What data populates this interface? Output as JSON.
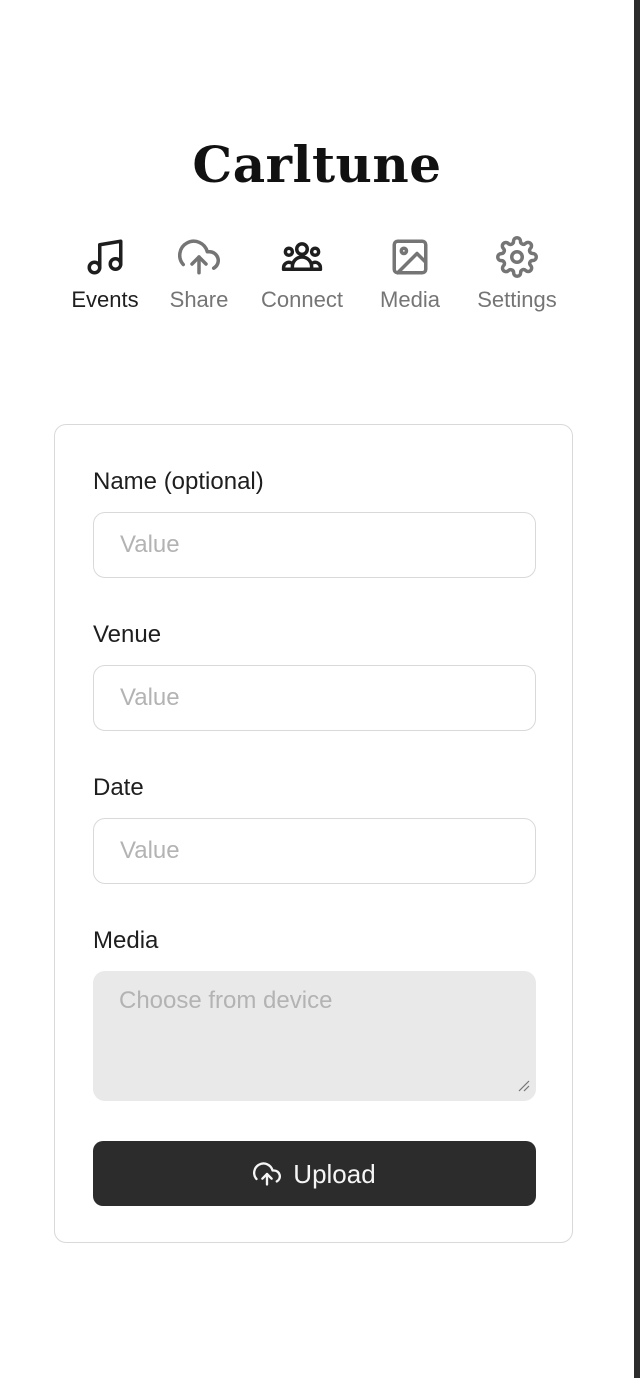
{
  "app": {
    "title": "Carltune"
  },
  "nav": {
    "items": [
      {
        "label": "Events",
        "icon": "music-note-icon",
        "active": true
      },
      {
        "label": "Share",
        "icon": "upload-cloud-icon",
        "active": false
      },
      {
        "label": "Connect",
        "icon": "users-icon",
        "active": false
      },
      {
        "label": "Media",
        "icon": "image-icon",
        "active": false
      },
      {
        "label": "Settings",
        "icon": "gear-icon",
        "active": false
      }
    ]
  },
  "form": {
    "name_label": "Name (optional)",
    "name_placeholder": "Value",
    "venue_label": "Venue",
    "venue_placeholder": "Value",
    "date_label": "Date",
    "date_placeholder": "Value",
    "media_label": "Media",
    "media_placeholder": "Choose from device",
    "upload_label": "Upload",
    "upload_icon": "upload-cloud-icon"
  },
  "colors": {
    "primary_button": "#2c2c2c",
    "active_nav": "#1e1e1e",
    "inactive_nav": "#757575",
    "border": "#d9d9d9",
    "textarea_bg": "#e9e9e9",
    "placeholder": "#b3b3b3"
  }
}
